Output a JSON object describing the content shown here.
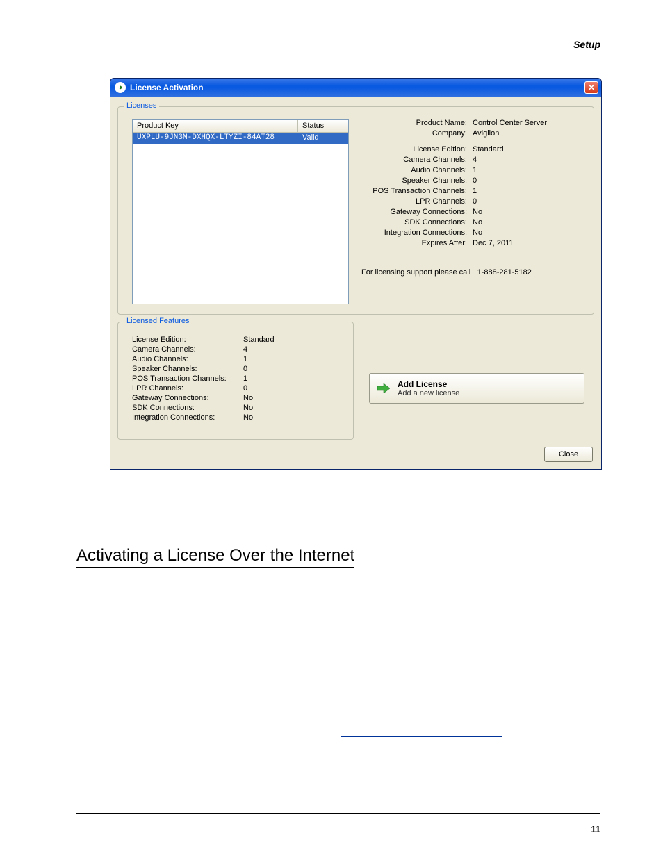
{
  "page": {
    "header_label": "Setup",
    "page_number": "11",
    "section_heading": "Activating a License Over the Internet"
  },
  "dialog": {
    "title": "License Activation",
    "close_btn_glyph": "✕",
    "groups": {
      "licenses_legend": "Licenses",
      "features_legend": "Licensed Features"
    },
    "listview": {
      "col_product_key": "Product Key",
      "col_status": "Status",
      "rows": [
        {
          "product_key": "UXPLU-9JN3M-DXHQX-LTYZI-84AT28",
          "status": "Valid",
          "selected": true
        }
      ]
    },
    "details": {
      "Product Name:": "Control Center Server",
      "Company:": "Avigilon",
      "License Edition:": "Standard",
      "Camera Channels:": "4",
      "Audio Channels:": "1",
      "Speaker Channels:": "0",
      "POS Transaction Channels:": "1",
      "LPR Channels:": "0",
      "Gateway Connections:": "No",
      "SDK Connections:": "No",
      "Integration Connections:": "No",
      "Expires After:": "Dec 7, 2011"
    },
    "support_note": "For licensing support please call +1-888-281-5182",
    "features": {
      "License Edition:": "Standard",
      "Camera Channels:": "4",
      "Audio Channels:": "1",
      "Speaker Channels:": "0",
      "POS Transaction Channels:": "1",
      "LPR Channels:": "0",
      "Gateway Connections:": "No",
      "SDK Connections:": "No",
      "Integration Connections:": "No"
    },
    "add_license": {
      "title": "Add License",
      "subtitle": "Add a new license"
    },
    "footer_close": "Close"
  }
}
